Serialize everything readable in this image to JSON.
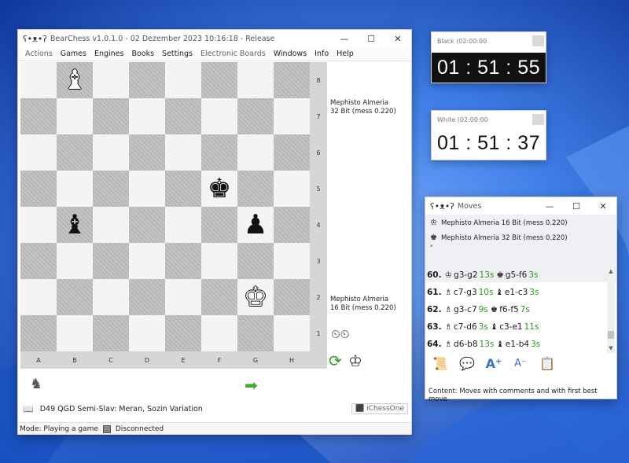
{
  "main_window": {
    "title": "BearChess v1.0.1.0 - 02 Dezember 2023  10:16:18 - Release",
    "app_icon": "bear-icon",
    "menu": [
      "Actions",
      "Games",
      "Engines",
      "Books",
      "Settings",
      "Electronic Boards",
      "Windows",
      "Info",
      "Help"
    ],
    "files": [
      "A",
      "B",
      "C",
      "D",
      "E",
      "F",
      "G",
      "H"
    ],
    "ranks": [
      "8",
      "7",
      "6",
      "5",
      "4",
      "3",
      "2",
      "1"
    ],
    "pieces": [
      {
        "square": "b8",
        "piece": "white-bishop",
        "glyph": "♝",
        "color": "white"
      },
      {
        "square": "f5",
        "piece": "black-king",
        "glyph": "♚",
        "color": "black"
      },
      {
        "square": "b4",
        "piece": "black-bishop",
        "glyph": "♝",
        "color": "black"
      },
      {
        "square": "g4",
        "piece": "black-pawn",
        "glyph": "♟",
        "color": "black"
      },
      {
        "square": "g2",
        "piece": "white-king",
        "glyph": "♚",
        "color": "white"
      }
    ],
    "black_player": {
      "line1": "Mephisto Almeria",
      "line2": "32 Bit (mess 0.220)"
    },
    "white_player": {
      "line1": "Mephisto Almeria",
      "line2": "16 Bit (mess 0.220)"
    },
    "opening": "D49 QGD Semi-Slav: Meran, Sozin Variation",
    "ichess_label": "iChessOne",
    "status_mode": "Mode: Playing a game",
    "status_connection": "Disconnected"
  },
  "clock_black": {
    "label": "Black (02:00:00",
    "time": "01 : 51 : 55"
  },
  "clock_white": {
    "label": "White (02:00:00",
    "time": "01 : 51 : 37"
  },
  "moves_window": {
    "title": "Moves",
    "engines": [
      {
        "icon": "white-king-icon",
        "glyph": "♔",
        "label": "Mephisto Almeria 16 Bit (mess 0.220)"
      },
      {
        "icon": "black-king-icon",
        "glyph": "♚",
        "label": "Mephisto Almeria 32 Bit (mess 0.220)"
      }
    ],
    "star": "*",
    "moves": [
      {
        "num": "60.",
        "w_glyph": "♔",
        "w": "g3-g2",
        "w_t": "13s",
        "b_glyph": "♚",
        "b": "g5-f6",
        "b_t": "3s"
      },
      {
        "num": "61.",
        "w_glyph": "♗",
        "w": "c7-g3",
        "w_t": "10s",
        "b_glyph": "♝",
        "b": "e1-c3",
        "b_t": "3s"
      },
      {
        "num": "62.",
        "w_glyph": "♗",
        "w": "g3-c7",
        "w_t": "9s",
        "b_glyph": "♚",
        "b": "f6-f5",
        "b_t": "7s"
      },
      {
        "num": "63.",
        "w_glyph": "♗",
        "w": "c7-d6",
        "w_t": "3s",
        "b_glyph": "♝",
        "b": "c3-e1",
        "b_t": "11s"
      },
      {
        "num": "64.",
        "w_glyph": "♗",
        "w": "d6-b8",
        "w_t": "13s",
        "b_glyph": "♝",
        "b": "e1-b4",
        "b_t": "3s"
      }
    ],
    "content": "Content: Moves with comments and with first best move"
  },
  "colors": {
    "accent_green": "#2a9a1b",
    "clock_black_bg": "#111111",
    "wallpaper": "#1c4fb3"
  }
}
